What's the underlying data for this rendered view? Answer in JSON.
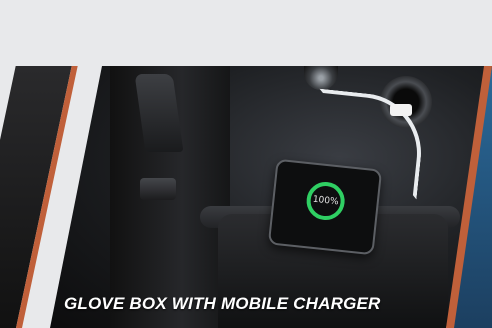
{
  "slides": {
    "current": {
      "caption": "GLOVE BOX WITH MOBILE CHARGER",
      "phone_display": "100%"
    }
  },
  "colors": {
    "accent_edge": "#c0603a",
    "charge_ring": "#2fcf63",
    "background": "#e8e9eb"
  },
  "icons": [
    "charging-ring-icon",
    "usb-plug-icon"
  ]
}
